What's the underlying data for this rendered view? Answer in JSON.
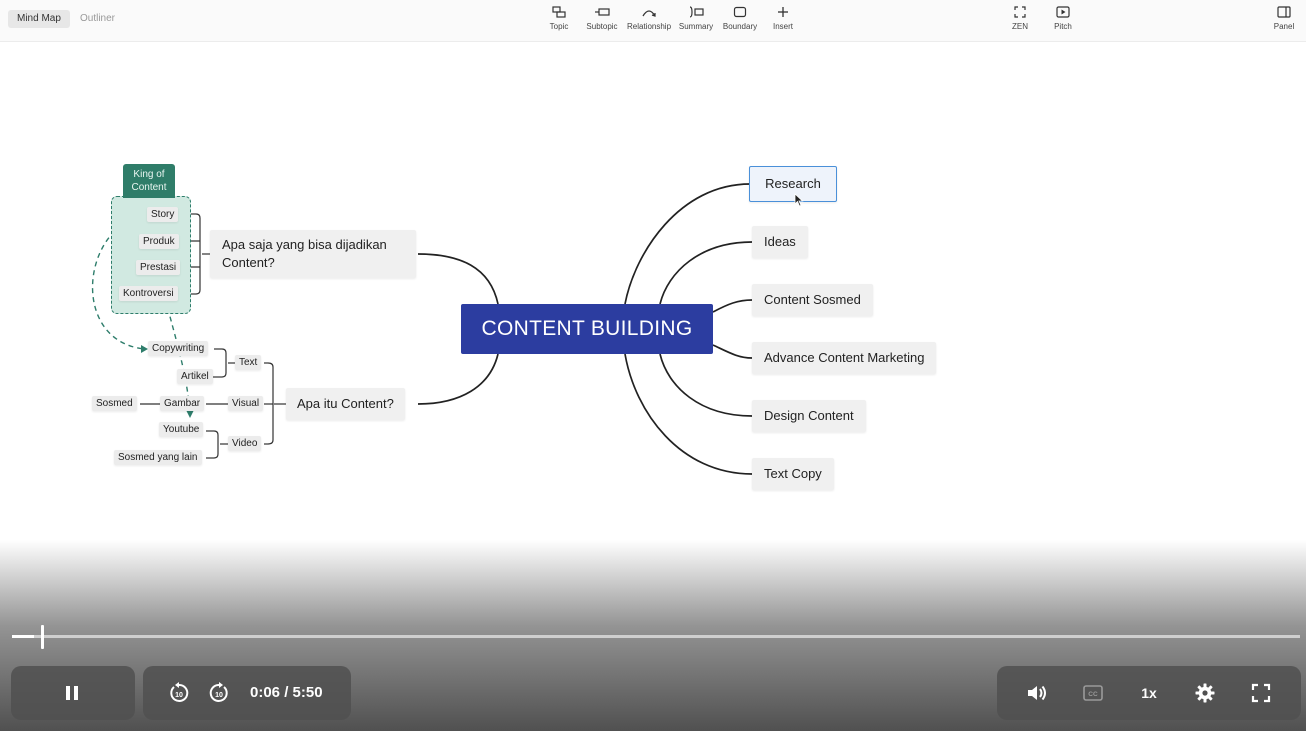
{
  "toolbar": {
    "tabs": [
      {
        "label": "Mind Map",
        "active": true
      },
      {
        "label": "Outliner",
        "active": false
      }
    ],
    "tools": [
      {
        "label": "Topic",
        "icon": "topic-icon"
      },
      {
        "label": "Subtopic",
        "icon": "subtopic-icon"
      },
      {
        "label": "Relationship",
        "icon": "relationship-icon"
      },
      {
        "label": "Summary",
        "icon": "summary-icon"
      },
      {
        "label": "Boundary",
        "icon": "boundary-icon"
      },
      {
        "label": "Insert",
        "icon": "plus-icon"
      }
    ],
    "view_tools": [
      {
        "label": "ZEN",
        "icon": "fullscreen-corners-icon"
      },
      {
        "label": "Pitch",
        "icon": "play-box-icon"
      }
    ],
    "panel": {
      "label": "Panel",
      "icon": "panel-icon"
    }
  },
  "mindmap": {
    "root": "CONTENT BUILDING",
    "right_topics": [
      "Research",
      "Ideas",
      "Content Sosmed",
      "Advance Content Marketing",
      "Design Content",
      "Text Copy"
    ],
    "selected_topic": "Research",
    "left_topic_1": {
      "label_line1": "Apa saja yang bisa dijadikan",
      "label_line2": "Content?",
      "children": [
        "Story",
        "Produk",
        "Prestasi",
        "Kontroversi"
      ],
      "boundary_label_line1": "King of",
      "boundary_label_line2": "Content"
    },
    "left_topic_2": {
      "label": "Apa itu Content?",
      "text": {
        "label": "Text",
        "children": [
          "Copywriting",
          "Artikel"
        ]
      },
      "visual": {
        "label": "Visual",
        "child": "Gambar",
        "grandchild": "Sosmed"
      },
      "video": {
        "label": "Video",
        "children": [
          "Youtube",
          "Sosmed yang lain"
        ]
      }
    },
    "colors": {
      "root": "#2c3da0",
      "boundary": "#2e7d6b",
      "boundary_fill": "#d1e9e1",
      "selection": "#4a90d9"
    }
  },
  "player": {
    "current_time": "0:06",
    "separator": "/",
    "duration": "5:50",
    "progress": 0.017,
    "speed": "1x",
    "icons": [
      "pause-icon",
      "rewind-10-icon",
      "forward-10-icon",
      "volume-icon",
      "captions-icon",
      "settings-gear-icon",
      "fullscreen-icon"
    ]
  }
}
